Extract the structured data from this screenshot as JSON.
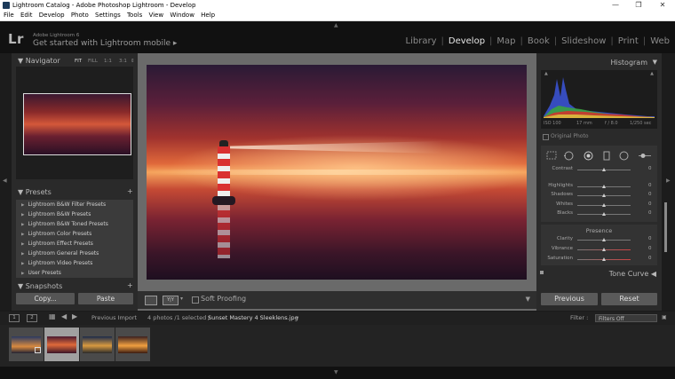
{
  "window": {
    "title": "Lightroom Catalog - Adobe Photoshop Lightroom - Develop",
    "minimize": "—",
    "maximize": "❐",
    "close": "✕"
  },
  "menu": [
    "File",
    "Edit",
    "Develop",
    "Photo",
    "Settings",
    "Tools",
    "View",
    "Window",
    "Help"
  ],
  "identity": {
    "logo": "Lr",
    "version": "Adobe Lightroom 6",
    "mobile": "Get started with Lightroom mobile ▸"
  },
  "modules": [
    "Library",
    "Develop",
    "Map",
    "Book",
    "Slideshow",
    "Print",
    "Web"
  ],
  "active_module": "Develop",
  "navigator": {
    "title": "Navigator",
    "zoom": [
      "FIT",
      "FILL",
      "1:1",
      "3:1"
    ]
  },
  "presets": {
    "title": "Presets",
    "add": "+",
    "items": [
      "Lightroom B&W Filter Presets",
      "Lightroom B&W Presets",
      "Lightroom B&W Toned Presets",
      "Lightroom Color Presets",
      "Lightroom Effect Presets",
      "Lightroom General Presets",
      "Lightroom Video Presets",
      "User Presets"
    ]
  },
  "snapshots": {
    "title": "Snapshots",
    "add": "+"
  },
  "left_buttons": {
    "copy": "Copy...",
    "paste": "Paste"
  },
  "toolbar": {
    "soft_proofing": "Soft Proofing"
  },
  "histogram": {
    "title": "Histogram",
    "iso": "ISO 100",
    "focal": "17 mm",
    "aperture": "f / 8.0",
    "shutter": "1/250 sec",
    "original_photo": "Original Photo"
  },
  "basic": {
    "sliders": [
      {
        "label": "Contrast",
        "value": "0"
      },
      {
        "label": "Highlights",
        "value": "0"
      },
      {
        "label": "Shadows",
        "value": "0"
      },
      {
        "label": "Whites",
        "value": "0"
      },
      {
        "label": "Blacks",
        "value": "0"
      }
    ]
  },
  "presence": {
    "title": "Presence",
    "sliders": [
      {
        "label": "Clarity",
        "value": "0"
      },
      {
        "label": "Vibrance",
        "value": "0"
      },
      {
        "label": "Saturation",
        "value": "0"
      }
    ]
  },
  "tone_curve": "Tone Curve",
  "right_buttons": {
    "previous": "Previous",
    "reset": "Reset"
  },
  "filmstrip": {
    "page1": "1",
    "page2": "2",
    "source": "Previous Import",
    "count": "4 photos /1 selected /",
    "filename": "Sunset Mastery 4 Sleeklens.jpg",
    "filter_label": "Filter :",
    "filter_value": "Filters Off"
  },
  "colors": {
    "accent": "#e6e6e6",
    "panel": "#2a2a2a",
    "background": "#1b1b1b"
  }
}
